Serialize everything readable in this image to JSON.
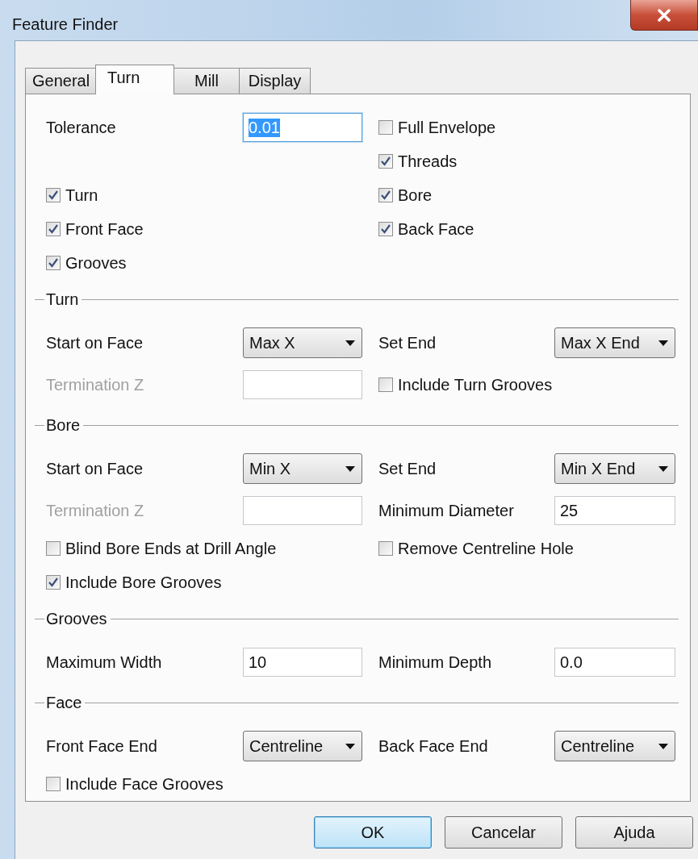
{
  "window": {
    "title": "Feature Finder"
  },
  "tabs": [
    {
      "label": "General",
      "selected": false
    },
    {
      "label": "Turn",
      "selected": true
    },
    {
      "label": "Mill",
      "selected": false
    },
    {
      "label": "Display",
      "selected": false
    }
  ],
  "top": {
    "rows": [
      {
        "left": {
          "kind": "field",
          "label": "Tolerance",
          "value": "0.01",
          "highlighted": true,
          "disabled": false
        },
        "right": {
          "kind": "checkbox",
          "label": "Full Envelope",
          "checked": false
        }
      },
      {
        "right": {
          "kind": "checkbox",
          "label": "Threads",
          "checked": true
        }
      },
      {
        "left": {
          "kind": "checkbox",
          "label": "Turn",
          "checked": true
        },
        "right": {
          "kind": "checkbox",
          "label": "Bore",
          "checked": true
        }
      },
      {
        "left": {
          "kind": "checkbox",
          "label": "Front Face",
          "checked": true
        },
        "right": {
          "kind": "checkbox",
          "label": "Back Face",
          "checked": true
        }
      },
      {
        "left": {
          "kind": "checkbox",
          "label": "Grooves",
          "checked": true
        }
      }
    ]
  },
  "groups": [
    {
      "title": "Turn",
      "rows": [
        {
          "left": {
            "kind": "dropdown",
            "label": "Start on Face",
            "value": "Max X"
          },
          "right": {
            "kind": "dropdown",
            "label": "Set End",
            "value": "Max X End"
          }
        },
        {
          "left": {
            "kind": "field",
            "label": "Termination Z",
            "highlighted": false,
            "disabled": true
          },
          "right": {
            "kind": "checkbox",
            "label": "Include Turn Grooves",
            "checked": false
          }
        }
      ]
    },
    {
      "title": "Bore",
      "rows": [
        {
          "left": {
            "kind": "dropdown",
            "label": "Start on Face",
            "value": "Min X"
          },
          "right": {
            "kind": "dropdown",
            "label": "Set End",
            "value": "Min X End"
          }
        },
        {
          "left": {
            "kind": "field",
            "label": "Termination Z",
            "highlighted": false,
            "disabled": true
          },
          "right": {
            "kind": "field",
            "label": "Minimum Diameter",
            "value": "25",
            "highlighted": false,
            "disabled": false
          }
        },
        {
          "left": {
            "kind": "checkbox",
            "label": "Blind Bore Ends at Drill Angle",
            "checked": false
          },
          "right": {
            "kind": "checkbox",
            "label": "Remove Centreline Hole",
            "checked": false
          }
        },
        {
          "left": {
            "kind": "checkbox",
            "label": "Include Bore Grooves",
            "checked": true
          }
        }
      ]
    },
    {
      "title": "Grooves",
      "rows": [
        {
          "left": {
            "kind": "field",
            "label": "Maximum Width",
            "value": "10",
            "highlighted": false,
            "disabled": false
          },
          "right": {
            "kind": "field",
            "label": "Minimum Depth",
            "value": "0.0",
            "highlighted": false,
            "disabled": false
          }
        }
      ]
    },
    {
      "title": "Face",
      "rows": [
        {
          "left": {
            "kind": "dropdown",
            "label": "Front Face End",
            "value": "Centreline"
          },
          "right": {
            "kind": "dropdown",
            "label": "Back Face End",
            "value": "Centreline"
          }
        },
        {
          "left": {
            "kind": "checkbox",
            "label": "Include Face Grooves",
            "checked": false
          }
        }
      ]
    }
  ],
  "buttons": [
    {
      "label": "OK",
      "default": true
    },
    {
      "label": "Cancelar",
      "default": false
    },
    {
      "label": "Ajuda",
      "default": false
    }
  ]
}
